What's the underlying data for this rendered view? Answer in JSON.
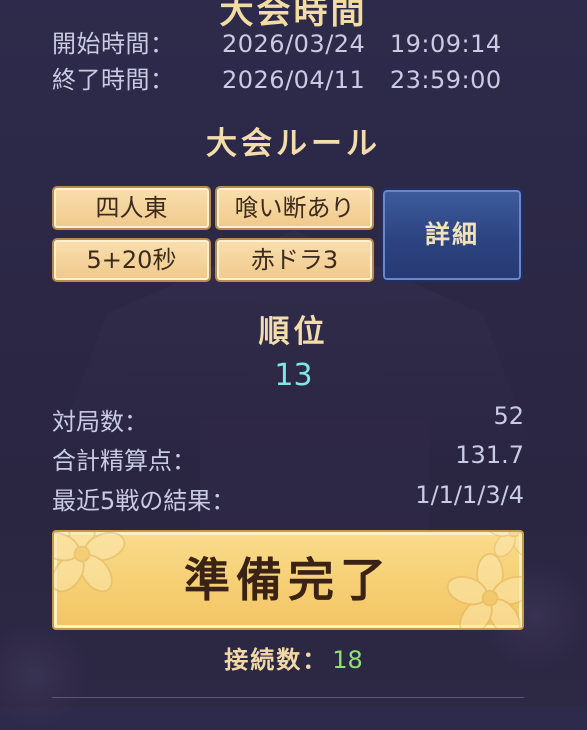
{
  "header": {
    "title": "大会時間"
  },
  "schedule": {
    "start_label": "開始時間：",
    "start_value": "2026/03/24　19:09:14",
    "end_label": "終了時間：",
    "end_value": "2026/04/11　23:59:00"
  },
  "rules": {
    "title": "大会ルール",
    "items": [
      "四人東",
      "喰い断あり",
      "5+20秒",
      "赤ドラ3"
    ],
    "detail_label": "詳細"
  },
  "rank": {
    "label": "順位",
    "value": "13"
  },
  "stats": [
    {
      "label": "対局数：",
      "value": "52"
    },
    {
      "label": "合計精算点：",
      "value": "131.7"
    },
    {
      "label": "最近5戦の結果：",
      "value": "1/1/1/3/4"
    }
  ],
  "ready_button": {
    "label": "準備完了"
  },
  "connection": {
    "label": "接続数：",
    "value": "18"
  },
  "colors": {
    "background": "#2c2846",
    "gold_text": "#f3ddab",
    "rank_cyan": "#7de8e4",
    "connection_green": "#8fe07a",
    "rule_button": "#f4d29a",
    "detail_button": "#2d4381",
    "ready_button": "#f6cf73"
  },
  "icons": {
    "decoration": "sakura-flower-icon"
  }
}
